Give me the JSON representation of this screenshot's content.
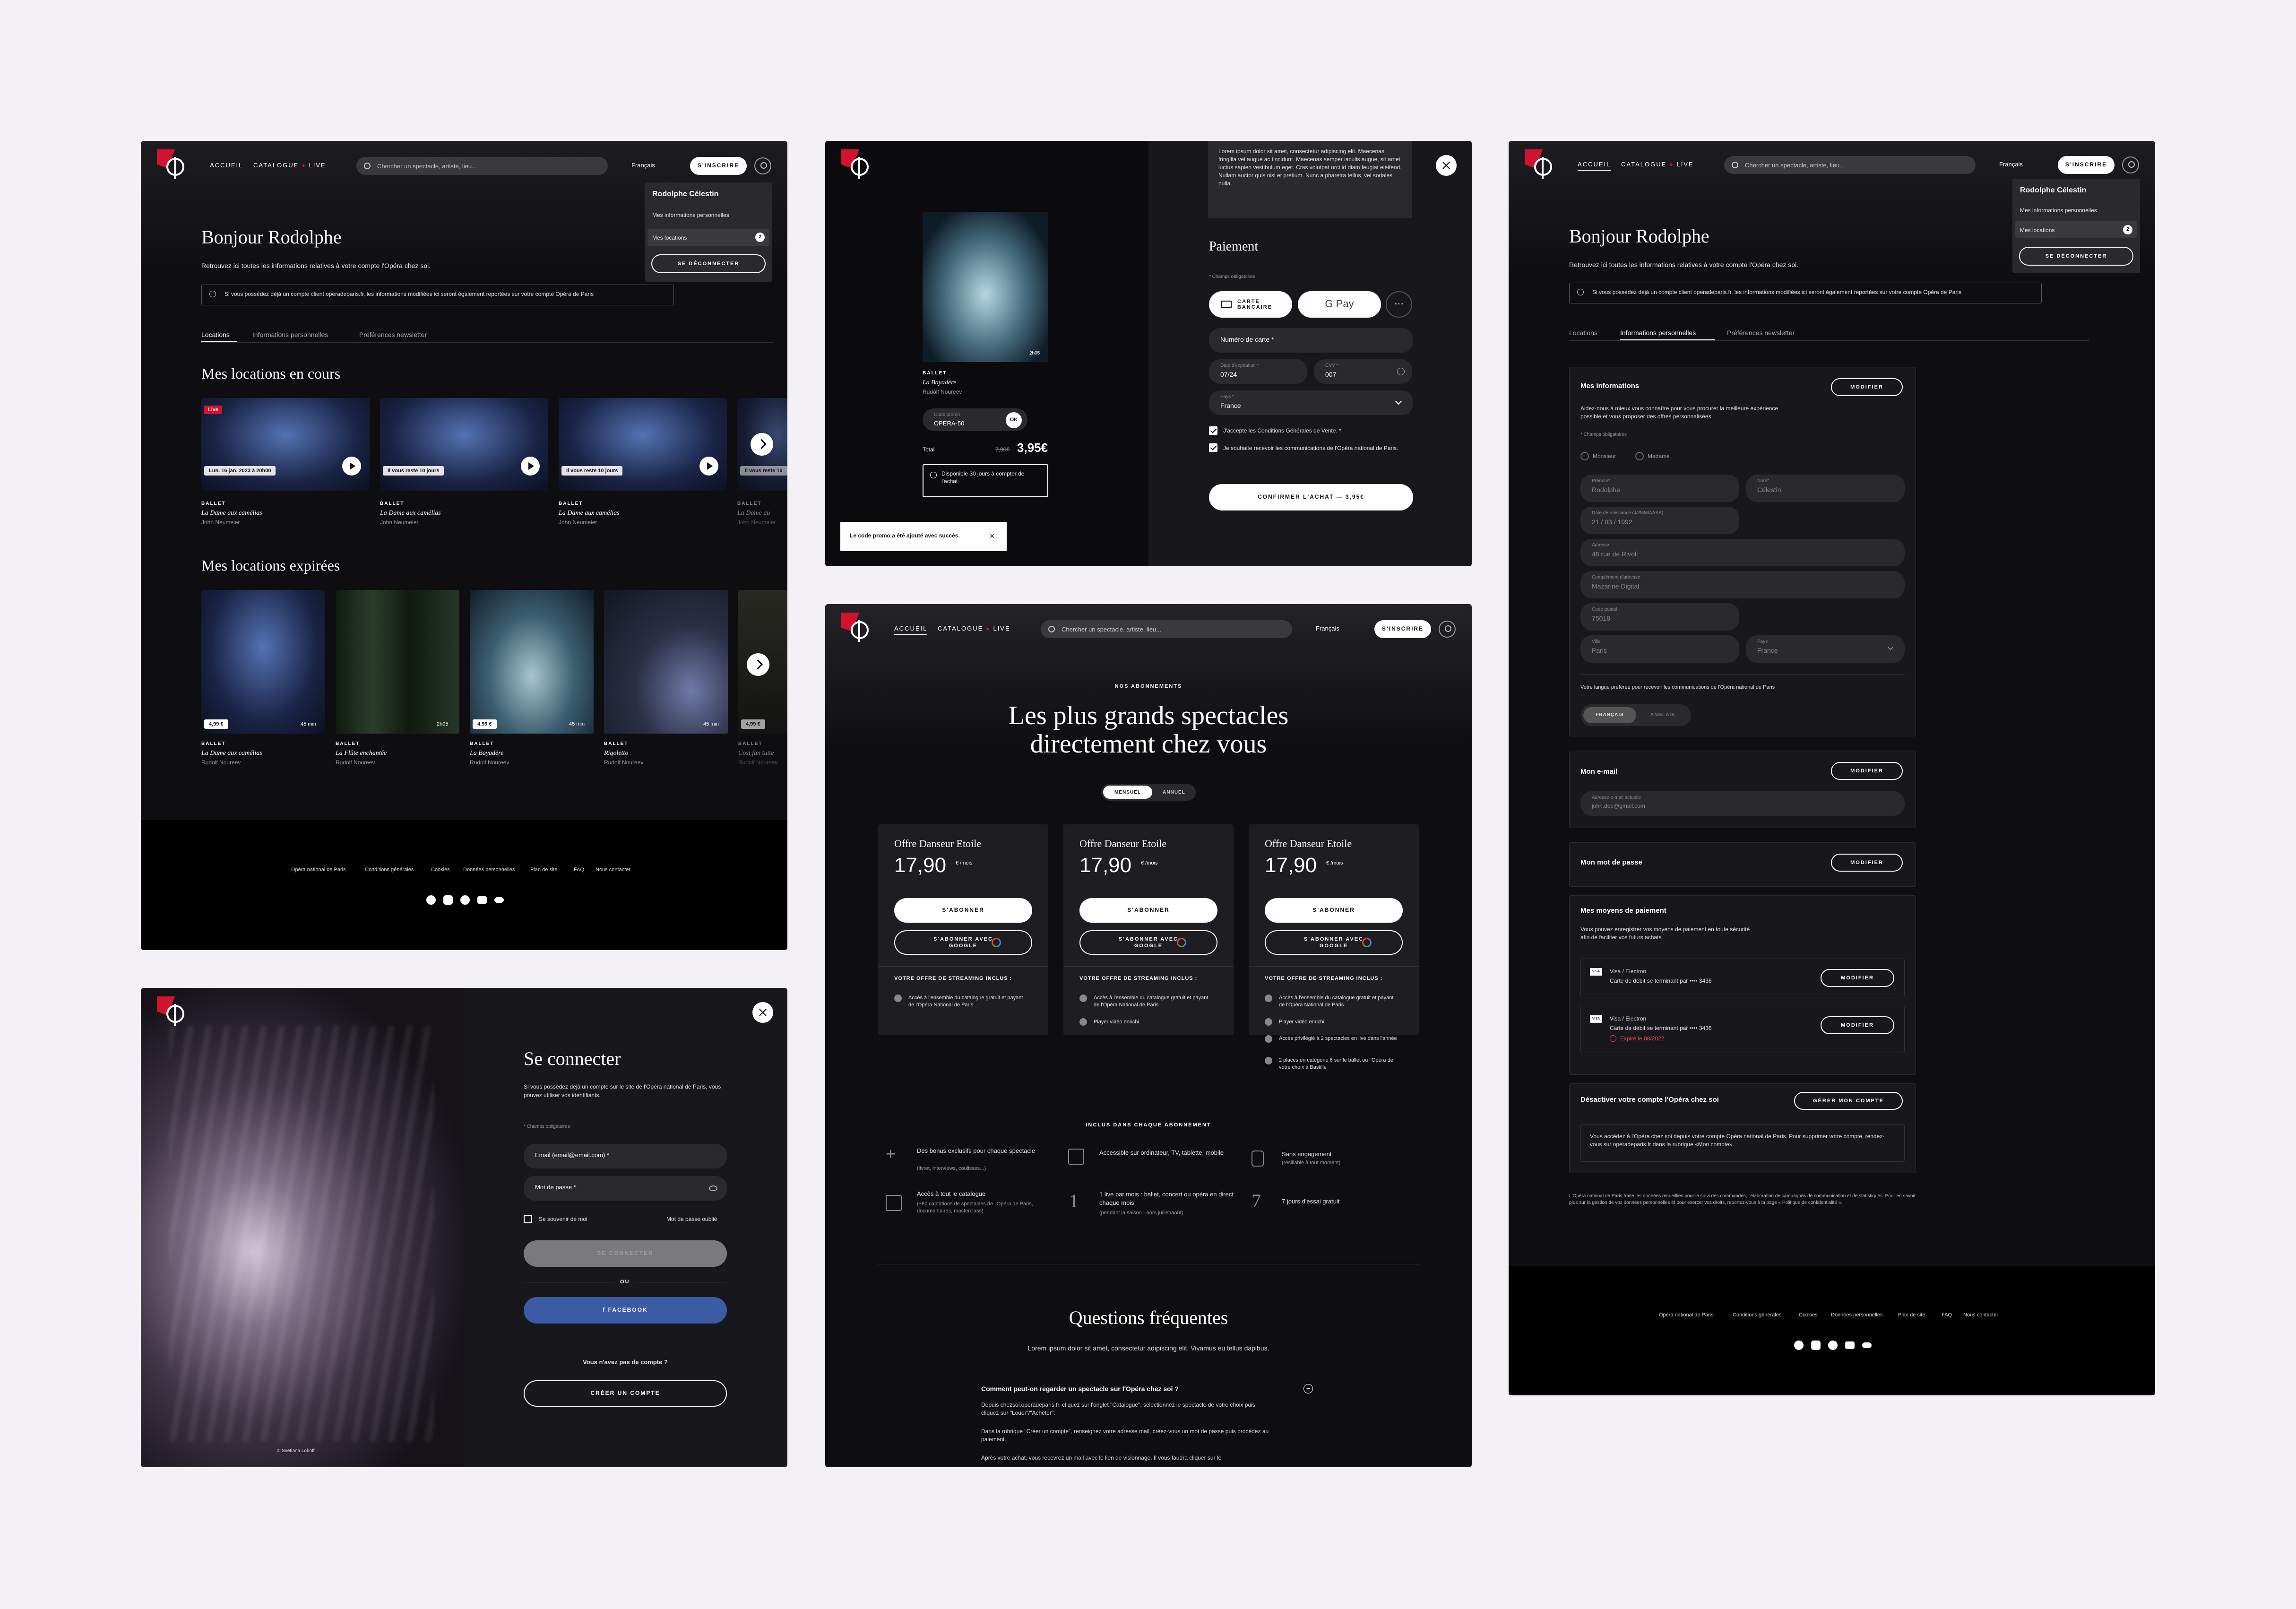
{
  "nav": {
    "accueil": "ACCUEIL",
    "catalogue": "CATALOGUE",
    "live": "LIVE",
    "search_placeholder": "Chercher un spectacle, artiste, lieu...",
    "lang": "Français",
    "signup": "S'INSCRIRE"
  },
  "dropdown": {
    "name": "Rodolphe Célestin",
    "personal": "Mes informations personnelles",
    "locations": "Mes locations",
    "count": "2",
    "logout": "SE DÉCONNECTER"
  },
  "account": {
    "greeting": "Bonjour Rodolphe",
    "intro": "Retrouvez ici toutes les informations relatives à votre compte l'Opéra chez soi.",
    "notice": "Si vous possédez déjà un compte client operadeparis.fr, les informations modifiées ici seront également reportées sur votre compte Opéra de Paris",
    "tabs": [
      "Locations",
      "Informations personnelles",
      "Préférences newsletter"
    ],
    "current_title": "Mes locations en cours",
    "current": [
      {
        "badge": "Live",
        "info": "Lun. 16 jan. 2023 à 20h00",
        "genre": "BALLET",
        "title": "La Dame aux camélias",
        "author": "John Neumeier"
      },
      {
        "badge": "",
        "info": "Il vous reste 10 jours",
        "genre": "BALLET",
        "title": "La Dame aux camélias",
        "author": "John Neumeier"
      },
      {
        "badge": "",
        "info": "Il vous reste 10 jours",
        "genre": "BALLET",
        "title": "La Dame aux camélias",
        "author": "John Neumeier"
      },
      {
        "badge": "",
        "info": "Il vous reste 10",
        "genre": "BALLET",
        "title": "La Dame au",
        "author": "John Neumeier"
      }
    ],
    "expired_title": "Mes locations expirées",
    "expired": [
      {
        "price": "4,99 €",
        "dur": "45 min",
        "genre": "BALLET",
        "title": "La Dame aux camélias",
        "author": "Rudolf Noureev"
      },
      {
        "price": "",
        "dur": "2h05",
        "genre": "BALLET",
        "title": "La Flûte enchantée",
        "author": "Rudolf Noureev"
      },
      {
        "price": "4,99 €",
        "dur": "45 min",
        "genre": "BALLET",
        "title": "La Bayadère",
        "author": "Rudolf Noureev"
      },
      {
        "price": "",
        "dur": "45 min",
        "genre": "BALLET",
        "title": "Rigoletto",
        "author": "Rudolf Noureev"
      },
      {
        "price": "4,99 €",
        "dur": "",
        "genre": "BALLET",
        "title": "Cosi fan tutte",
        "author": "Rudolf Noureev"
      }
    ]
  },
  "footer_links": [
    "Opéra national de Paris",
    "Conditions générales",
    "Cookies",
    "Données personnelles",
    "Plan de site",
    "FAQ",
    "Nous contacter"
  ],
  "payment": {
    "lorem": "Lorem ipsum dolor sit amet, consectetur adipiscing elit. Maecenas fringilla vel augue ac tincidunt. Maecenas semper iaculis augue, sit amet luctus sapien vestibulum eget. Cras volutpat orci id diam feugiat eleifend. Nullam auctor quis nisl et pretium. Nunc a pharetra tellus, vel sodales nulla.",
    "dur": "2h05",
    "genre": "BALLET",
    "title": "La Bayadère",
    "author": "Rudolf Noureev",
    "promo_label": "Code promo",
    "promo_value": "OPERA-50",
    "ok": "OK",
    "total_label": "Total",
    "old_price": "7,90€",
    "price": "3,95€",
    "availability": "Disponible 30 jours à compter de l'achat",
    "toast": "Le code promo a été ajouté avec succès.",
    "section": "Paiement",
    "required": "* Champs obligatoires",
    "card_btn": "CARTE BANCAIRE",
    "gpay": "G Pay",
    "card_number": "Numéro de carte *",
    "exp_label": "Date d'expiration *",
    "exp_value": "07/24",
    "cvv_label": "CVV *",
    "cvv_value": "007",
    "country_label": "Pays *",
    "country_value": "France",
    "cgv": "J'accepte les Conditions Générales de Vente. *",
    "newsletter": "Je souhaite recevoir les communications de l'Opéra national de Paris.",
    "confirm": "CONFIRMER L'ACHAT — 3,95€"
  },
  "login": {
    "credit": "© Svetlana Loboff",
    "title": "Se connecter",
    "intro": "Si vous possédez déjà un compte sur le site de l'Opéra national de Paris, vous pouvez utiliser vos identifiants.",
    "required": "* Champs obligatoires",
    "email": "Email (email@email.com) *",
    "password": "Mot de passe *",
    "remember": "Se souvenir de moi",
    "forgot": "Mot de passe oublié",
    "connect": "SE CONNECTER",
    "or": "OU",
    "facebook": "FACEBOOK",
    "no_account": "Vous n'avez pas de compte ?",
    "create": "CRÉER UN COMPTE"
  },
  "subs": {
    "eyebrow": "NOS ABONNEMENTS",
    "title1": "Les plus grands spectacles",
    "title2": "directement chez vous",
    "monthly": "MENSUEL",
    "yearly": "ANNUEL",
    "offers": [
      {
        "name": "Offre Danseur Etoile",
        "price": "17,90",
        "unit": "€ /mois",
        "features": [
          "Accès à l'ensemble du catalogue gratuit et payant de l'Opéra National de Paris"
        ]
      },
      {
        "name": "Offre Danseur Etoile",
        "price": "17,90",
        "unit": "€ /mois",
        "features": [
          "Accès à l'ensemble du catalogue gratuit et payant de l'Opéra National de Paris",
          "Player vidéo enrichi"
        ]
      },
      {
        "name": "Offre Danseur Etoile",
        "price": "17,90",
        "unit": "€ /mois",
        "features": [
          "Accès à l'ensemble du catalogue gratuit et payant de l'Opéra National de Paris",
          "Player vidéo enrichi",
          "Accès privilégié à 2 spectacles en live dans l'année",
          "2 places en catégorie 6 sur le ballet ou l'Opéra de votre choix à Bastille"
        ]
      }
    ],
    "subscribe": "S'ABONNER",
    "subscribe_google": "S'ABONNER AVEC GOOGLE",
    "includes": "VOTRE OFFRE DE STREAMING INCLUS :",
    "included_title": "INCLUS DANS CHAQUE ABONNEMENT",
    "perks": [
      {
        "t": "Des bonus exclusifs pour chaque spectacle",
        "s": "(livret, interviews, coulisses...)"
      },
      {
        "t": "Accessible sur ordinateur, TV, tablette, mobile",
        "s": ""
      },
      {
        "t": "Sans engagement",
        "s": "(résiliable à tout moment)"
      },
      {
        "t": "Accès à tout le catalogue",
        "s": "(+80 captations de spectacles de l'Opéra de Paris, documentaires, masterclass)"
      },
      {
        "t": "1 live par mois : ballet, concert ou opéra en direct chaque mois",
        "s": "(pendant la saison - hors juillet/août)"
      },
      {
        "t": "7 jours d'essai gratuit",
        "s": ""
      }
    ],
    "faq_title": "Questions fréquentes",
    "faq_intro": "Lorem ipsum dolor sit amet, consectetur adipiscing elit. Vivamus eu tellus dapibus.",
    "faq_q": "Comment peut-on regarder un spectacle sur l'Opéra chez soi ?",
    "faq_a1": "Depuis chezsoi.operadeparis.fr, cliquez sur l'onglet \"Catalogue\", sélectionnez le spectacle de votre choix puis cliquez sur \"Louer\"/\"Acheter\".",
    "faq_a2": "Dans la rubrique \"Créer un compte\", renseignez votre adresse mail, créez-vous un mot de passe puis procédez au paiement.",
    "faq_a3": "Après votre achat, vous recevrez un mail avec le lien de visionnage. Il vous faudra cliquer sur le"
  },
  "info": {
    "title": "Mes informations",
    "desc": "Aidez-nous à mieux vous connaître pour vous procurer la meilleure expérience possible et vous proposer des offres personnalisées.",
    "required": "* Champs obligatoires",
    "mr": "Monsieur",
    "mrs": "Madame",
    "first_label": "Prénom*",
    "first": "Rodolphe",
    "last_label": "Nom*",
    "last": "Célestin",
    "dob_label": "Date de naissance (JJ/MM/AAAA)",
    "dob": "21 / 03 / 1992",
    "addr_label": "Adresse",
    "addr": "48 rue de Rivoli",
    "addr2_label": "Complément d'adresse",
    "addr2": "Mazarine Digital",
    "zip_label": "Code postal",
    "zip": "75018",
    "city_label": "Ville",
    "city": "Paris",
    "country_label": "Pays",
    "country": "France",
    "lang_q": "Votre langue préférée pour recevoir les communications de l'Opéra national de Paris",
    "fr": "FRANÇAIS",
    "en": "ANGLAIS",
    "modify": "MODIFIER",
    "email_title": "Mon e-mail",
    "email_label": "Adresse e-mail actuelle",
    "email": "john.doe@gmail.com",
    "pwd_title": "Mon mot de passe",
    "pay_title": "Mes moyens de paiement",
    "pay_desc": "Vous pouvez enregistrer vos moyens de paiement en toute sécurité afin de faciliter vos futurs achats.",
    "cards": [
      {
        "brand": "VISA",
        "name": "Visa / Electron",
        "detail": "Carte de débit se terminant par •••• 3436",
        "exp": ""
      },
      {
        "brand": "VISA",
        "name": "Visa / Electron",
        "detail": "Carte de débit se terminant par •••• 3436",
        "exp": "Expiré le 08/2022"
      }
    ],
    "deact_title": "Désactiver votre compte l'Opéra chez soi",
    "manage": "GÉRER MON COMPTE",
    "deact_text": "Vous accédez à l'Opéra chez soi depuis votre compte Opéra national de Paris. Pour supprimer votre compte, rendez-vous sur operadeparis.fr dans la rubrique «Mon compte».",
    "legal": "L'Opéra national de Paris traite les données recueillies pour le suivi des commandes, l'élaboration de campagnes de communication et de statistiques. Pour en savoir plus sur la gestion de vos données personnelles et pour exercer vos droits, reportez-vous à la page « Politique de confidentialité »."
  },
  "colors": {
    "bg": "#f3f1f6",
    "panel": "#0e0d10",
    "accent": "#d2122e",
    "facebook": "#3b5ba5"
  }
}
